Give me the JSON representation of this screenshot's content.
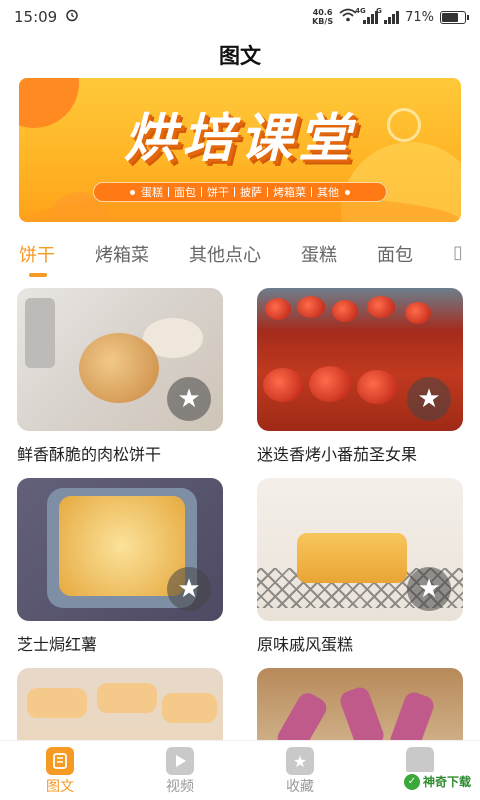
{
  "status_bar": {
    "time": "15:09",
    "net_speed_value": "40.6",
    "net_speed_unit": "KB/S",
    "signal_1_label": "4G",
    "signal_2_label": "G",
    "battery": "71%",
    "battery_level": 0.71
  },
  "header": {
    "title": "图文"
  },
  "banner": {
    "title": "烘培课堂",
    "tags": [
      "蛋糕",
      "面包",
      "饼干",
      "披萨",
      "烤箱菜",
      "其他"
    ]
  },
  "tabs": [
    {
      "label": "饼干",
      "active": true
    },
    {
      "label": "烤箱菜",
      "active": false
    },
    {
      "label": "其他点心",
      "active": false
    },
    {
      "label": "蛋糕",
      "active": false
    },
    {
      "label": "面包",
      "active": false
    }
  ],
  "cards": [
    {
      "title": "鲜香酥脆的肉松饼干",
      "icon": "star-icon"
    },
    {
      "title": "迷迭香烤小番茄圣女果",
      "icon": "star-icon"
    },
    {
      "title": "芝士焗红薯",
      "icon": "star-icon"
    },
    {
      "title": "原味戚风蛋糕",
      "icon": "star-icon"
    },
    {
      "title": "",
      "icon": ""
    },
    {
      "title": "",
      "icon": ""
    }
  ],
  "bottom_nav": [
    {
      "label": "图文",
      "icon": "book-icon",
      "active": true
    },
    {
      "label": "视频",
      "icon": "play-icon",
      "active": false
    },
    {
      "label": "收藏",
      "icon": "star-icon",
      "active": false
    }
  ],
  "watermark": {
    "text": "神奇下载"
  },
  "colors": {
    "accent": "#f59a23",
    "inactive": "#999999"
  }
}
